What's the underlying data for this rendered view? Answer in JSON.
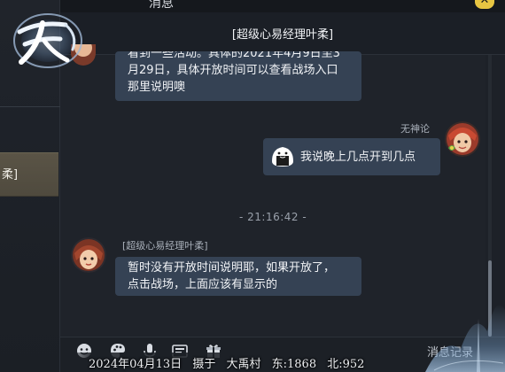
{
  "window": {
    "title": "消息",
    "close_glyph": "✕"
  },
  "logo": {
    "text": "天刀",
    "icon": "game-logo-icon"
  },
  "sidebar": {
    "selected_item_label": "柔]"
  },
  "chat": {
    "header_title": "[超级心易经理叶柔]",
    "messages": [
      {
        "sender": "[超级心易经理叶柔]",
        "side": "left",
        "text_line_partial": "看到一些活动。具体的2021年4月9日至3",
        "text_line_2": "月29日，具体开放时间可以查看战场入口",
        "text_line_3": "那里说明噢"
      },
      {
        "sender": "无神论",
        "side": "right",
        "emoji_icon": "rice-ball-emoji-icon",
        "text": "我说晚上几点开到几点"
      },
      {
        "sender": "[超级心易经理叶柔]",
        "side": "left",
        "text_line_1": "暂时没有开放时间说明耶，如果开放了，",
        "text_line_2": "点击战场，上面应该有显示的"
      }
    ],
    "timestamp": "- 21:16:42 -"
  },
  "toolbar": {
    "icons": [
      "emoji-icon",
      "palette-icon",
      "microphone-icon",
      "image-icon",
      "gift-icon"
    ],
    "records_label": "消息记录"
  },
  "status": {
    "date": "2024年04月13日",
    "action": "摄于",
    "location": "大禹村",
    "east": "东:1868",
    "north": "北:952"
  },
  "colors": {
    "background": "#1f232a",
    "bubble": "#354254",
    "accent_gold": "#e7c542",
    "sidebar_selected": "#5a5446"
  }
}
